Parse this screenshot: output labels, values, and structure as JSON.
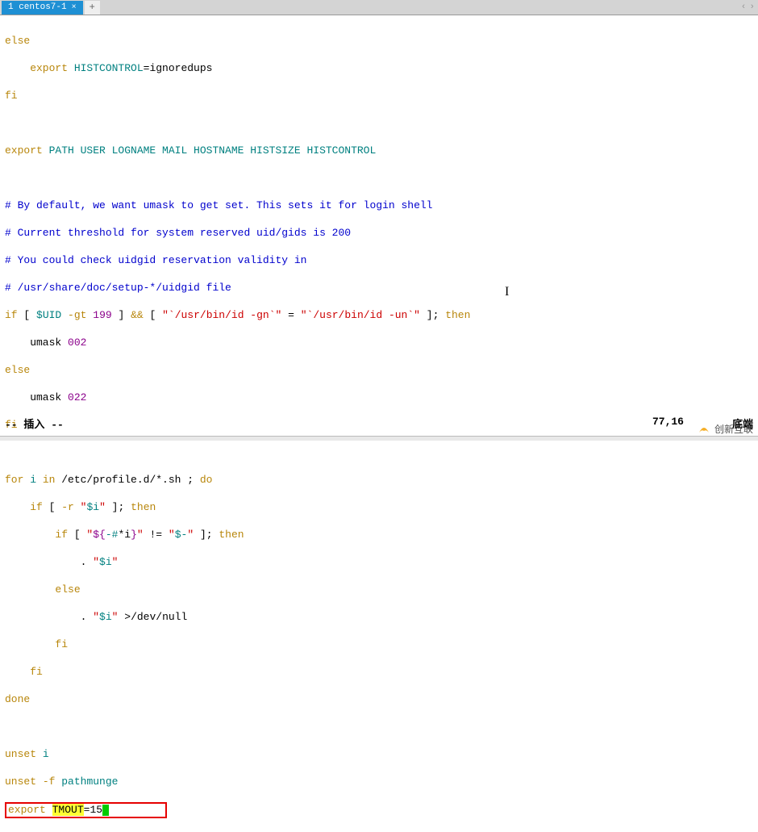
{
  "tab": {
    "label": "1 centos7-1",
    "close": "×",
    "add": "+"
  },
  "nav": {
    "left": "‹",
    "right": "›"
  },
  "code": {
    "l1a": "else",
    "l2a": "    export",
    "l2b": " HISTCONTROL",
    "l2c": "=",
    "l2d": "ignoredups",
    "l3a": "fi",
    "l4a": "export",
    "l4b": " PATH USER LOGNAME MAIL HOSTNAME HISTSIZE HISTCONTROL",
    "l5a": "# By default, we want umask to get set. This sets it for login shell",
    "l6a": "# Current threshold for system reserved uid/gids is 200",
    "l7a": "# You could check uidgid reservation validity in",
    "l8a": "# /usr/share/doc/setup-*/uidgid file",
    "l9a": "if",
    "l9b": " [ ",
    "l9c": "$UID",
    "l9d": " ",
    "l9e": "-gt",
    "l9f": " ",
    "l9g": "199",
    "l9h": " ] ",
    "l9i": "&&",
    "l9j": " [ ",
    "l9k": "\"`/usr/bin/id -gn`\"",
    "l9l": " = ",
    "l9m": "\"`/usr/bin/id -un`\"",
    "l9n": " ]; ",
    "l9o": "then",
    "l10a": "    umask ",
    "l10b": "002",
    "l11a": "else",
    "l12a": "    umask ",
    "l12b": "022",
    "l13a": "fi",
    "l14a": "for",
    "l14b": " i ",
    "l14c": "in",
    "l14d": " /etc/profile.d/*.sh ; ",
    "l14e": "do",
    "l15a": "    if",
    "l15b": " [ ",
    "l15c": "-r",
    "l15d": " ",
    "l15e": "\"",
    "l15f": "$i",
    "l15g": "\"",
    "l15h": " ]; ",
    "l15i": "then",
    "l16a": "        if",
    "l16b": " [ ",
    "l16c": "\"",
    "l16d": "${",
    "l16e": "-#",
    "l16f": "*i",
    "l16g": "}",
    "l16h": "\"",
    "l16i": " != ",
    "l16j": "\"",
    "l16k": "$-",
    "l16l": "\"",
    "l16m": " ]; ",
    "l16n": "then",
    "l17a": "            . ",
    "l17b": "\"",
    "l17c": "$i",
    "l17d": "\"",
    "l18a": "        else",
    "l19a": "            . ",
    "l19b": "\"",
    "l19c": "$i",
    "l19d": "\"",
    "l19e": " >",
    "l19f": "/dev/null",
    "l20a": "        fi",
    "l21a": "    fi",
    "l22a": "done",
    "l23a": "unset",
    "l23b": " i",
    "l24a": "unset",
    "l24b": " ",
    "l24c": "-f",
    "l24d": " ",
    "l24e": "pathmunge",
    "l25a": "export",
    "l25b": " ",
    "l25c": "TMOUT",
    "l25d": "=15"
  },
  "status": {
    "mode": "-- 插入 --",
    "pos": "77,16",
    "pct": "底端"
  },
  "watermark": {
    "text": "创新互联"
  }
}
